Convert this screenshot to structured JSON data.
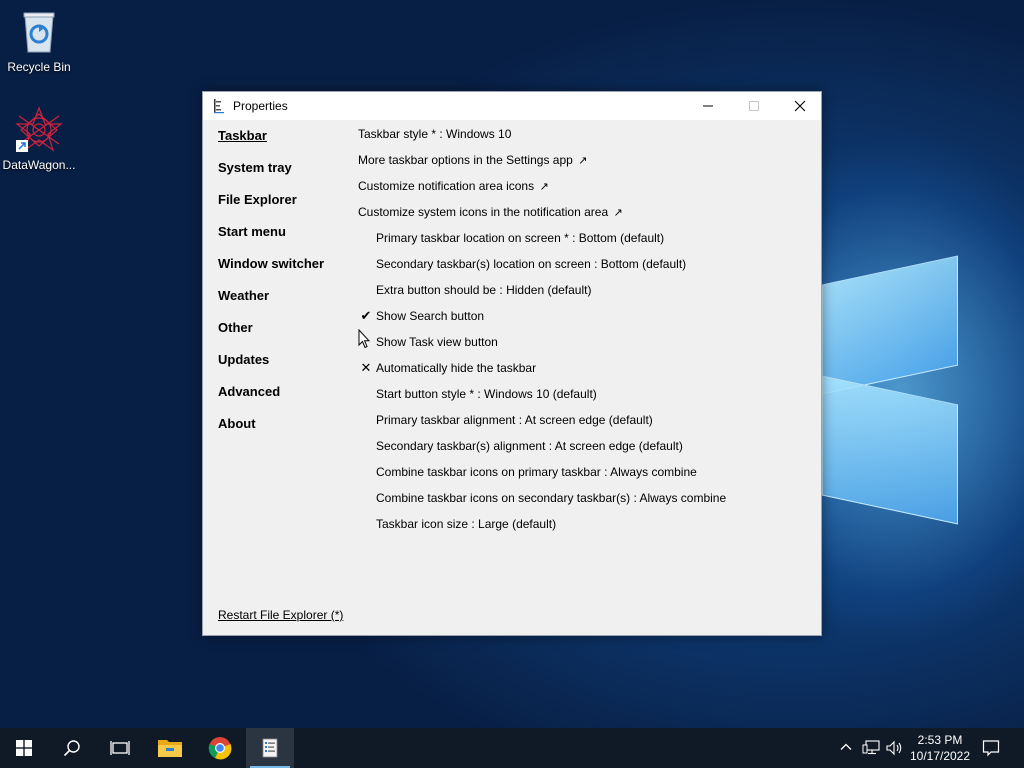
{
  "desktop": {
    "icons": [
      {
        "label": "Recycle Bin",
        "icon": "recycle-bin-icon"
      },
      {
        "label": "DataWagon...",
        "icon": "datawagon-shortcut-icon"
      }
    ]
  },
  "window": {
    "title": "Properties",
    "caption_buttons": [
      "minimize",
      "maximize",
      "close"
    ],
    "sidebar": {
      "items": [
        {
          "label": "Taskbar",
          "active": true
        },
        {
          "label": "System tray"
        },
        {
          "label": "File Explorer"
        },
        {
          "label": "Start menu"
        },
        {
          "label": "Window switcher"
        },
        {
          "label": "Weather"
        },
        {
          "label": "Other"
        },
        {
          "label": "Updates"
        },
        {
          "label": "Advanced"
        },
        {
          "label": "About"
        }
      ],
      "restart_link": "Restart File Explorer (*)"
    },
    "options": [
      {
        "label": "Taskbar style * : Windows 10",
        "indent": false,
        "mark": ""
      },
      {
        "label": "More taskbar options in the Settings app",
        "indent": false,
        "mark": "",
        "external": "↗"
      },
      {
        "label": "Customize notification area icons",
        "indent": false,
        "mark": "",
        "external": "↗"
      },
      {
        "label": "Customize system icons in the notification area",
        "indent": false,
        "mark": "",
        "external": "↗"
      },
      {
        "label": "Primary taskbar location on screen * : Bottom (default)",
        "indent": true,
        "mark": ""
      },
      {
        "label": "Secondary taskbar(s) location on screen : Bottom (default)",
        "indent": true,
        "mark": ""
      },
      {
        "label": "Extra button should be : Hidden (default)",
        "indent": true,
        "mark": ""
      },
      {
        "label": "Show Search button",
        "indent": true,
        "mark": "✔"
      },
      {
        "label": "Show Task view button",
        "indent": true,
        "mark": ""
      },
      {
        "label": "Automatically hide the taskbar",
        "indent": true,
        "mark": "✕"
      },
      {
        "label": "Start button style * : Windows 10 (default)",
        "indent": true,
        "mark": ""
      },
      {
        "label": "Primary taskbar alignment : At screen edge (default)",
        "indent": true,
        "mark": ""
      },
      {
        "label": "Secondary taskbar(s) alignment : At screen edge (default)",
        "indent": true,
        "mark": ""
      },
      {
        "label": "Combine taskbar icons on primary taskbar : Always combine",
        "indent": true,
        "mark": ""
      },
      {
        "label": "Combine taskbar icons on secondary taskbar(s) : Always combine",
        "indent": true,
        "mark": ""
      },
      {
        "label": "Taskbar icon size : Large (default)",
        "indent": true,
        "mark": ""
      }
    ]
  },
  "taskbar": {
    "buttons": [
      "start-icon",
      "search-icon",
      "task-view-icon",
      "file-explorer-icon",
      "chrome-icon",
      "properties-app-icon"
    ],
    "tray": [
      "chevron-up-icon",
      "network-icon",
      "volume-icon"
    ],
    "clock": {
      "time": "2:53 PM",
      "date": "10/17/2022"
    },
    "notification_icon": "action-center-icon"
  },
  "colors": {
    "taskbar_bg": "#101a26",
    "window_bg": "#f0f0f0",
    "accent": "#76b9ed"
  }
}
